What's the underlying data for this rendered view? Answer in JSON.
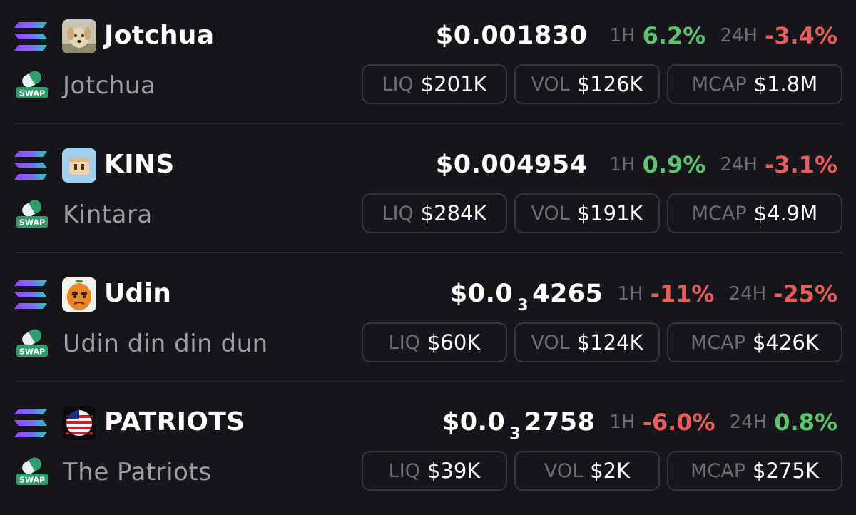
{
  "tokens": [
    {
      "symbol": "Jotchua",
      "name": "Jotchua",
      "price_main": "$0.001830",
      "price_sub": "",
      "price_tail": "",
      "h1_label": "1H",
      "h1_change": "6.2%",
      "h1_direction": "up",
      "h24_label": "24H",
      "h24_change": "-3.4%",
      "h24_direction": "down",
      "liq_label": "LIQ",
      "liq_value": "$201K",
      "vol_label": "VOL",
      "vol_value": "$126K",
      "mcap_label": "MCAP",
      "mcap_value": "$1.8M",
      "avatar_icon": "dog-avatar-icon"
    },
    {
      "symbol": "KINS",
      "name": "Kintara",
      "price_main": "$0.004954",
      "price_sub": "",
      "price_tail": "",
      "h1_label": "1H",
      "h1_change": "0.9%",
      "h1_direction": "up",
      "h24_label": "24H",
      "h24_change": "-3.1%",
      "h24_direction": "down",
      "liq_label": "LIQ",
      "liq_value": "$284K",
      "vol_label": "VOL",
      "vol_value": "$191K",
      "mcap_label": "MCAP",
      "mcap_value": "$4.9M",
      "avatar_icon": "pixel-face-avatar-icon"
    },
    {
      "symbol": "Udin",
      "name": "Udin din din dun",
      "price_main": "$0.0",
      "price_sub": "3",
      "price_tail": "4265",
      "h1_label": "1H",
      "h1_change": "-11%",
      "h1_direction": "down",
      "h24_label": "24H",
      "h24_change": "-25%",
      "h24_direction": "down",
      "liq_label": "LIQ",
      "liq_value": "$60K",
      "vol_label": "VOL",
      "vol_value": "$124K",
      "mcap_label": "MCAP",
      "mcap_value": "$426K",
      "avatar_icon": "orange-character-avatar-icon"
    },
    {
      "symbol": "PATRIOTS",
      "name": "The Patriots",
      "price_main": "$0.0",
      "price_sub": "3",
      "price_tail": "2758",
      "h1_label": "1H",
      "h1_change": "-6.0%",
      "h1_direction": "down",
      "h24_label": "24H",
      "h24_change": "0.8%",
      "h24_direction": "up",
      "liq_label": "LIQ",
      "liq_value": "$39K",
      "vol_label": "VOL",
      "vol_value": "$2K",
      "mcap_label": "MCAP",
      "mcap_value": "$275K",
      "avatar_icon": "flag-avatar-icon"
    }
  ],
  "swap_badge_text": "SWAP",
  "colors": {
    "background": "#16161a",
    "positive": "#5dc36f",
    "negative": "#ea5c5c",
    "muted": "#6c6c75",
    "pill_border": "#34343c"
  }
}
